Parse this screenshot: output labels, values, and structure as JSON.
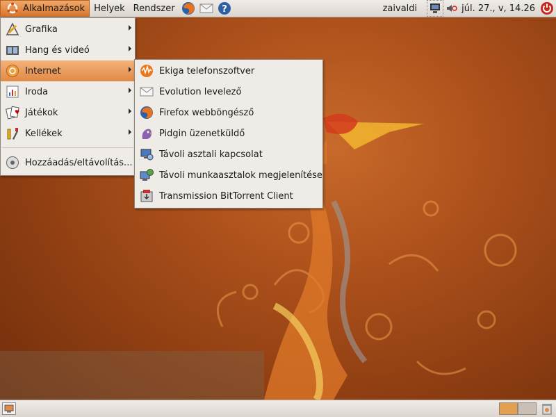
{
  "top_panel": {
    "menus": [
      "Alkalmazások",
      "Helyek",
      "Rendszer"
    ],
    "user": "zaivaldi",
    "clock": "júl. 27., v, 14.26"
  },
  "apps_menu": {
    "items": [
      {
        "label": "Grafika",
        "icon": "graphics-icon",
        "submenu": true
      },
      {
        "label": "Hang és videó",
        "icon": "sound-video-icon",
        "submenu": true
      },
      {
        "label": "Internet",
        "icon": "internet-icon",
        "submenu": true,
        "highlighted": true
      },
      {
        "label": "Iroda",
        "icon": "office-icon",
        "submenu": true
      },
      {
        "label": "Játékok",
        "icon": "games-icon",
        "submenu": true
      },
      {
        "label": "Kellékek",
        "icon": "accessories-icon",
        "submenu": true
      }
    ],
    "add_remove": "Hozzáadás/eltávolítás..."
  },
  "internet_menu": {
    "items": [
      {
        "label": "Ekiga telefonszoftver",
        "icon": "ekiga-icon"
      },
      {
        "label": "Evolution levelező",
        "icon": "evolution-mail-icon"
      },
      {
        "label": "Firefox webböngésző",
        "icon": "firefox-icon"
      },
      {
        "label": "Pidgin üzenetküldő",
        "icon": "pidgin-icon"
      },
      {
        "label": "Távoli asztali kapcsolat",
        "icon": "remote-desktop-icon"
      },
      {
        "label": "Távoli munkaasztalok megjelenítése",
        "icon": "remote-desktop-viewer-icon"
      },
      {
        "label": "Transmission BitTorrent Client",
        "icon": "transmission-icon"
      }
    ]
  },
  "colors": {
    "accent": "#e08a45",
    "panel": "#e6e1dc",
    "desktop": "#a8501b"
  }
}
